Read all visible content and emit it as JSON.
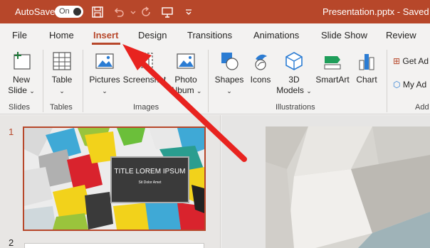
{
  "titlebar": {
    "autosave_label": "AutoSave",
    "autosave_state": "On",
    "filename": "Presentation.pptx  -  Saved",
    "icons": [
      "save-icon",
      "undo-icon",
      "redo-icon",
      "present-icon",
      "customize-icon"
    ]
  },
  "tabs": [
    "File",
    "Home",
    "Insert",
    "Design",
    "Transitions",
    "Animations",
    "Slide Show",
    "Review"
  ],
  "active_tab": "Insert",
  "ribbon": {
    "new_slide": {
      "line1": "New",
      "line2": "Slide"
    },
    "table": "Table",
    "pictures": "Pictures",
    "screenshot": "Screenshot",
    "photo_album": {
      "line1": "Photo",
      "line2": "Album"
    },
    "shapes": "Shapes",
    "icons": "Icons",
    "models_3d": {
      "line1": "3D",
      "line2": "Models"
    },
    "smartart": "SmartArt",
    "chart": "Chart",
    "get_addins": "Get Ad",
    "my_addins": "My Ad",
    "groups": {
      "slides": "Slides",
      "tables": "Tables",
      "images": "Images",
      "illustrations": "Illustrations",
      "addins": "Add"
    }
  },
  "thumbnails": {
    "slide1_number": "1",
    "slide2_number": "2",
    "title": "TITLE LOREM IPSUM",
    "subtitle": "Sit Dolor Amet"
  },
  "colors": {
    "accent": "#b7472a",
    "arrow": "#e8231f"
  }
}
